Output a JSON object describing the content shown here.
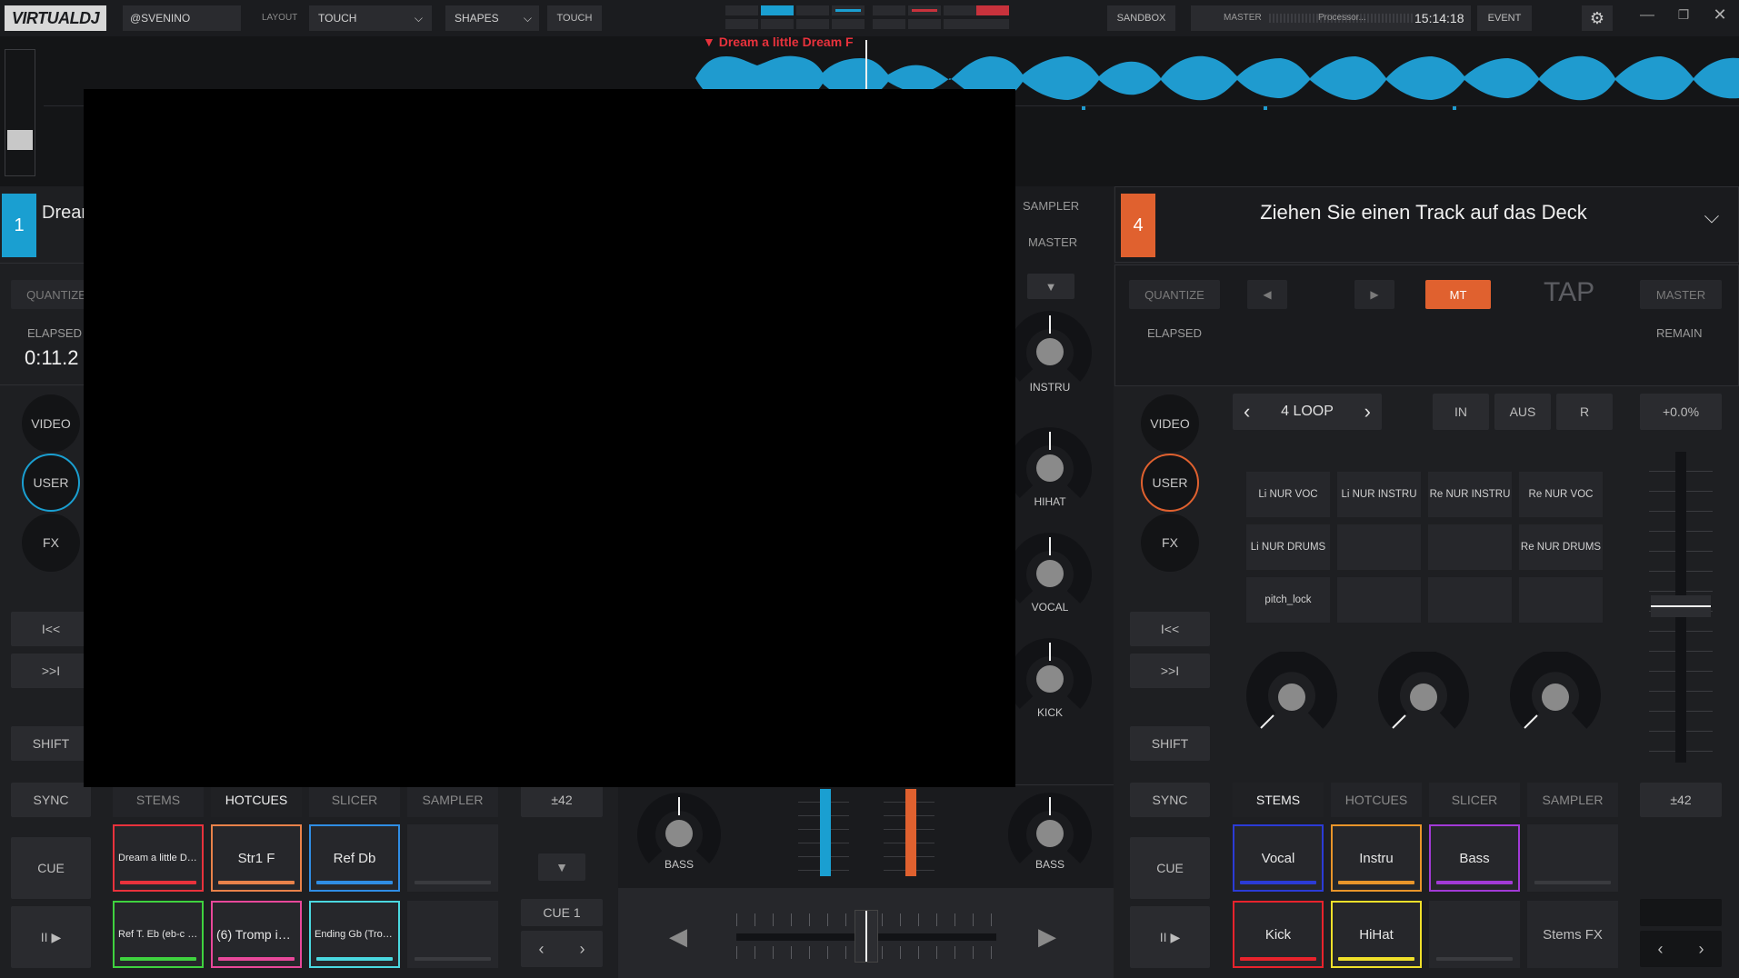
{
  "topbar": {
    "logo": "VIRTUALDJ",
    "user": "@SVENINO",
    "layout_label": "LAYOUT",
    "layout_value": "TOUCH",
    "shapes_value": "SHAPES",
    "touch_label": "TOUCH",
    "sandbox_label": "SANDBOX",
    "master_label": "MASTER",
    "processor_label": "Processor...",
    "clock": "15:14:18",
    "event_label": "EVENT"
  },
  "waveform": {
    "track_marker_title": "Dream a little Dream F",
    "wave_color": "#1f9bcf",
    "marker_color": "#e8323c"
  },
  "deck_left": {
    "number": "1",
    "title_partial": "Drear",
    "quantize_label": "QUANTIZE",
    "elapsed_label": "ELAPSED",
    "elapsed_value": "0:11.2",
    "accent": "#1a9fd1",
    "video_label": "VIDEO",
    "user_label": "USER",
    "fx_label": "FX",
    "prev_label": "I<<",
    "next_label": ">>I",
    "shift_label": "SHIFT",
    "sync_label": "SYNC",
    "cue_label": "CUE",
    "play_label": "II ▶",
    "tabs": [
      "STEMS",
      "HOTCUES",
      "SLICER",
      "SAMPLER"
    ],
    "active_tab": "HOTCUES",
    "pitch_range": "±42",
    "cue_nav_label": "CUE 1",
    "pads_row1": [
      {
        "label": "Dream a little Drea...",
        "color": "#e8323c"
      },
      {
        "label": "Str1 F",
        "color": "#e8824a"
      },
      {
        "label": "Ref Db",
        "color": "#2f8de4"
      },
      {
        "label": "",
        "color": "#3a3b3f"
      }
    ],
    "pads_row2": [
      {
        "label": "Ref T. Eb (eb-c b-g...",
        "color": "#3fd23f"
      },
      {
        "label": "(6) Tromp in G",
        "color": "#e8489a"
      },
      {
        "label": "Ending Gb (Tromp...",
        "color": "#4ad8e0"
      },
      {
        "label": "",
        "color": "#3a3b3f"
      }
    ]
  },
  "mixer": {
    "sampler_label": "SAMPLER",
    "master_label": "MASTER",
    "knobs": [
      "INSTRU",
      "HIHAT",
      "VOCAL",
      "KICK"
    ],
    "bass_left": "BASS",
    "bass_right": "BASS",
    "left_level_color": "#1a9fd1",
    "right_level_color": "#e0612f"
  },
  "deck_right": {
    "number": "4",
    "empty_text": "Ziehen Sie einen Track auf das Deck",
    "accent": "#e0612f",
    "quantize_label": "QUANTIZE",
    "mt_label": "MT",
    "tap_label": "TAP",
    "master_label": "MASTER",
    "elapsed_label": "ELAPSED",
    "remain_label": "REMAIN",
    "video_label": "VIDEO",
    "user_label": "USER",
    "fx_label": "FX",
    "prev_label": "I<<",
    "next_label": ">>I",
    "shift_label": "SHIFT",
    "sync_label": "SYNC",
    "cue_label": "CUE",
    "play_label": "II ▶",
    "loop_label": "4 LOOP",
    "in_label": "IN",
    "out_label": "AUS",
    "reloop_label": "R",
    "pitch_value": "+0.0%",
    "pitch_range": "±42",
    "stem_slots": [
      [
        "Li NUR VOC",
        "Li NUR INSTRU",
        "Re NUR INSTRU",
        "Re NUR VOC"
      ],
      [
        "Li NUR DRUMS",
        "",
        "",
        "Re NUR DRUMS"
      ],
      [
        "pitch_lock",
        "",
        "",
        ""
      ]
    ],
    "tabs": [
      "STEMS",
      "HOTCUES",
      "SLICER",
      "SAMPLER"
    ],
    "active_tab": "STEMS",
    "pads_row1": [
      {
        "label": "Vocal",
        "color": "#2b3bd6"
      },
      {
        "label": "Instru",
        "color": "#e8952a"
      },
      {
        "label": "Bass",
        "color": "#a23ad6"
      },
      {
        "label": "",
        "color": "#3a3b3f"
      }
    ],
    "pads_row2": [
      {
        "label": "Kick",
        "color": "#e8232c"
      },
      {
        "label": "HiHat",
        "color": "#f0e02a"
      },
      {
        "label": "",
        "color": "#3a3b3f"
      },
      {
        "label": "Stems FX",
        "color": "#3a3b3f"
      }
    ]
  }
}
